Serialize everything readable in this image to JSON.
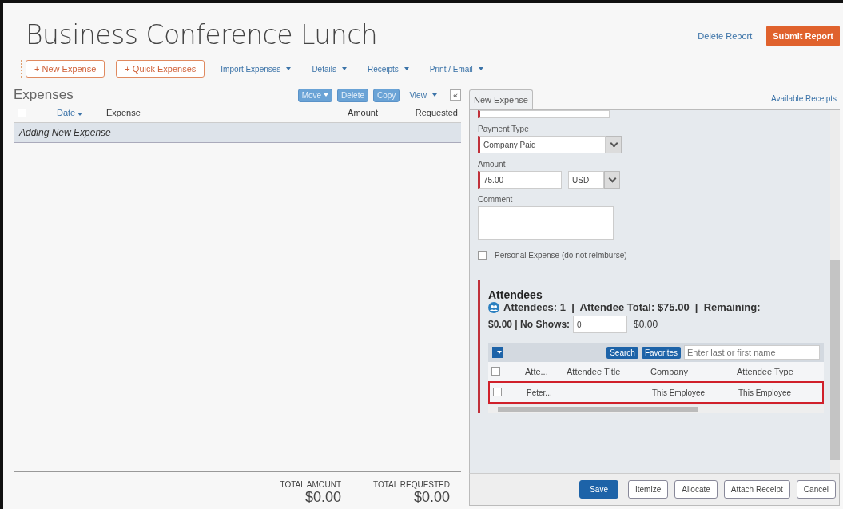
{
  "report": {
    "title": "Business Conference Lunch",
    "delete_link": "Delete Report",
    "submit_button": "Submit Report"
  },
  "toolbar": {
    "buttons": [
      "+ New Expense",
      "+ Quick Expenses"
    ],
    "menus": [
      "Import Expenses",
      "Details",
      "Receipts",
      "Print / Email"
    ]
  },
  "expenses": {
    "heading": "Expenses",
    "actions": [
      {
        "label": "Move",
        "caret": true
      },
      {
        "label": "Delete",
        "caret": false
      },
      {
        "label": "Copy",
        "caret": false
      }
    ],
    "view_menu": "View",
    "collapse": "«",
    "select_all_checked": false,
    "columns": [
      {
        "label": "Date",
        "sortable": true
      },
      {
        "label": "Expense",
        "sortable": false
      },
      {
        "label": "Amount",
        "sortable": false
      },
      {
        "label": "Requested",
        "sortable": false
      }
    ],
    "rows": [
      {
        "text": "Adding New Expense",
        "selected": true
      }
    ],
    "totals": [
      {
        "label": "TOTAL AMOUNT",
        "value": "$0.00"
      },
      {
        "label": "TOTAL REQUESTED",
        "value": "$0.00"
      }
    ]
  },
  "detail": {
    "tab": {
      "label": "New Expense",
      "selected": true
    },
    "receipts_link": "Available Receipts",
    "fields": [
      {
        "kind": "cut",
        "required": true
      },
      {
        "kind": "select",
        "label": "Payment Type",
        "value": "Company Paid",
        "required": true
      },
      {
        "kind": "amount",
        "label": "Amount",
        "value": "75.00",
        "currency": "USD",
        "required": true
      },
      {
        "kind": "textarea",
        "label": "Comment",
        "required": false
      },
      {
        "kind": "checkbox",
        "label": "Personal Expense (do not reimburse)",
        "checked": false
      }
    ],
    "attendees": {
      "heading": "Attendees",
      "summary": "Attendees: 1  |  Attendee Total: $75.00  |  Remaining:",
      "remaining": "$0.00 | No Shows:",
      "no_shows": "0",
      "no_show_amount": "$0.00",
      "search_button": "Search",
      "favorites_button": "Favorites",
      "search_placeholder": "Enter last or first name",
      "select_all_checked": false,
      "columns": [
        "Atte...",
        "Attendee Title",
        "Company",
        "Attendee Type"
      ],
      "rows": [
        {
          "cells": [
            "Peter...",
            "",
            "This Employee",
            "This Employee"
          ],
          "checked": false,
          "highlighted": true
        }
      ]
    },
    "buttons": [
      {
        "label": "Save",
        "primary": true
      },
      {
        "label": "Itemize",
        "primary": false
      },
      {
        "label": "Allocate",
        "primary": false
      },
      {
        "label": "Attach Receipt",
        "primary": false
      },
      {
        "label": "Cancel",
        "primary": false
      }
    ]
  }
}
